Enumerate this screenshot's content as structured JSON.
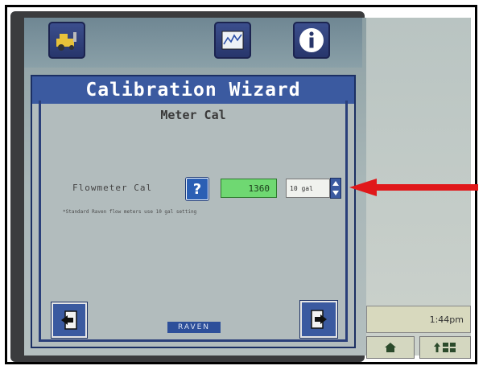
{
  "wizard": {
    "title": "Calibration Wizard",
    "subtitle": "Meter Cal",
    "flowmeter_label": "Flowmeter Cal",
    "help_label": "?",
    "cal_value": "1360",
    "unit": "10 gal",
    "note": "*Standard Raven flow meters use 10 gal setting"
  },
  "branding": {
    "logo_text": "RAVEN"
  },
  "status": {
    "time": "1:44pm"
  },
  "icons": {
    "top": [
      "setup-icon",
      "chart-icon",
      "info-icon"
    ],
    "nav": [
      "back-icon",
      "next-icon"
    ],
    "bottom": [
      "home-icon",
      "sort-icon"
    ]
  },
  "colors": {
    "title_bar": "#3b5aa0",
    "value_field": "#6fd872",
    "annotation_arrow": "#e0181a"
  }
}
